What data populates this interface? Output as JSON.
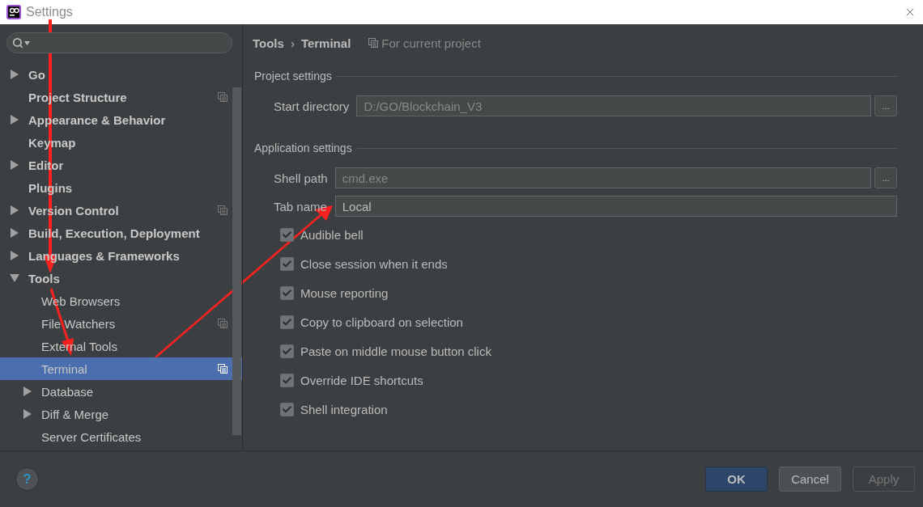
{
  "window": {
    "title": "Settings"
  },
  "sidebar": {
    "items": [
      {
        "label": "Go",
        "kind": "group",
        "expanded": false,
        "selected": false,
        "project_scoped": false
      },
      {
        "label": "Project Structure",
        "kind": "page",
        "selected": false,
        "project_scoped": true
      },
      {
        "label": "Appearance & Behavior",
        "kind": "group",
        "expanded": false,
        "selected": false,
        "project_scoped": false
      },
      {
        "label": "Keymap",
        "kind": "page",
        "selected": false,
        "project_scoped": false
      },
      {
        "label": "Editor",
        "kind": "group",
        "expanded": false,
        "selected": false,
        "project_scoped": false
      },
      {
        "label": "Plugins",
        "kind": "page",
        "selected": false,
        "project_scoped": false
      },
      {
        "label": "Version Control",
        "kind": "group",
        "expanded": false,
        "selected": false,
        "project_scoped": true
      },
      {
        "label": "Build, Execution, Deployment",
        "kind": "group",
        "expanded": false,
        "selected": false,
        "project_scoped": false
      },
      {
        "label": "Languages & Frameworks",
        "kind": "group",
        "expanded": false,
        "selected": false,
        "project_scoped": false
      },
      {
        "label": "Tools",
        "kind": "group",
        "expanded": true,
        "selected": false,
        "project_scoped": false,
        "children": [
          {
            "label": "Web Browsers",
            "kind": "page",
            "selected": false,
            "project_scoped": false
          },
          {
            "label": "File Watchers",
            "kind": "page",
            "selected": false,
            "project_scoped": true
          },
          {
            "label": "External Tools",
            "kind": "page",
            "selected": false,
            "project_scoped": false
          },
          {
            "label": "Terminal",
            "kind": "page",
            "selected": true,
            "project_scoped": true
          },
          {
            "label": "Database",
            "kind": "group",
            "expanded": false,
            "selected": false,
            "project_scoped": false
          },
          {
            "label": "Diff & Merge",
            "kind": "group",
            "expanded": false,
            "selected": false,
            "project_scoped": false
          },
          {
            "label": "Server Certificates",
            "kind": "page",
            "selected": false,
            "project_scoped": false
          }
        ]
      }
    ]
  },
  "header": {
    "breadcrumb": [
      "Tools",
      "Terminal"
    ],
    "separator": "›",
    "scope": "For current project"
  },
  "sections": [
    {
      "title": "Project settings",
      "fields": [
        {
          "label": "Start directory",
          "placeholder": "D:/GO/Blockchain_V3",
          "browse": "..."
        }
      ]
    },
    {
      "title": "Application settings",
      "fields": [
        {
          "label": "Shell path",
          "placeholder": "cmd.exe",
          "browse": "..."
        },
        {
          "label": "Tab name",
          "value": "Local"
        }
      ],
      "checkboxes": [
        {
          "label": "Audible bell",
          "checked": true
        },
        {
          "label": "Close session when it ends",
          "checked": true
        },
        {
          "label": "Mouse reporting",
          "checked": true
        },
        {
          "label": "Copy to clipboard on selection",
          "checked": true
        },
        {
          "label": "Paste on middle mouse button click",
          "checked": true
        },
        {
          "label": "Override IDE shortcuts",
          "checked": true
        },
        {
          "label": "Shell integration",
          "checked": true
        }
      ]
    }
  ],
  "footer": {
    "help": "?",
    "buttons": [
      {
        "label": "OK",
        "kind": "primary"
      },
      {
        "label": "Cancel",
        "kind": "normal"
      },
      {
        "label": "Apply",
        "kind": "disabled"
      }
    ]
  }
}
